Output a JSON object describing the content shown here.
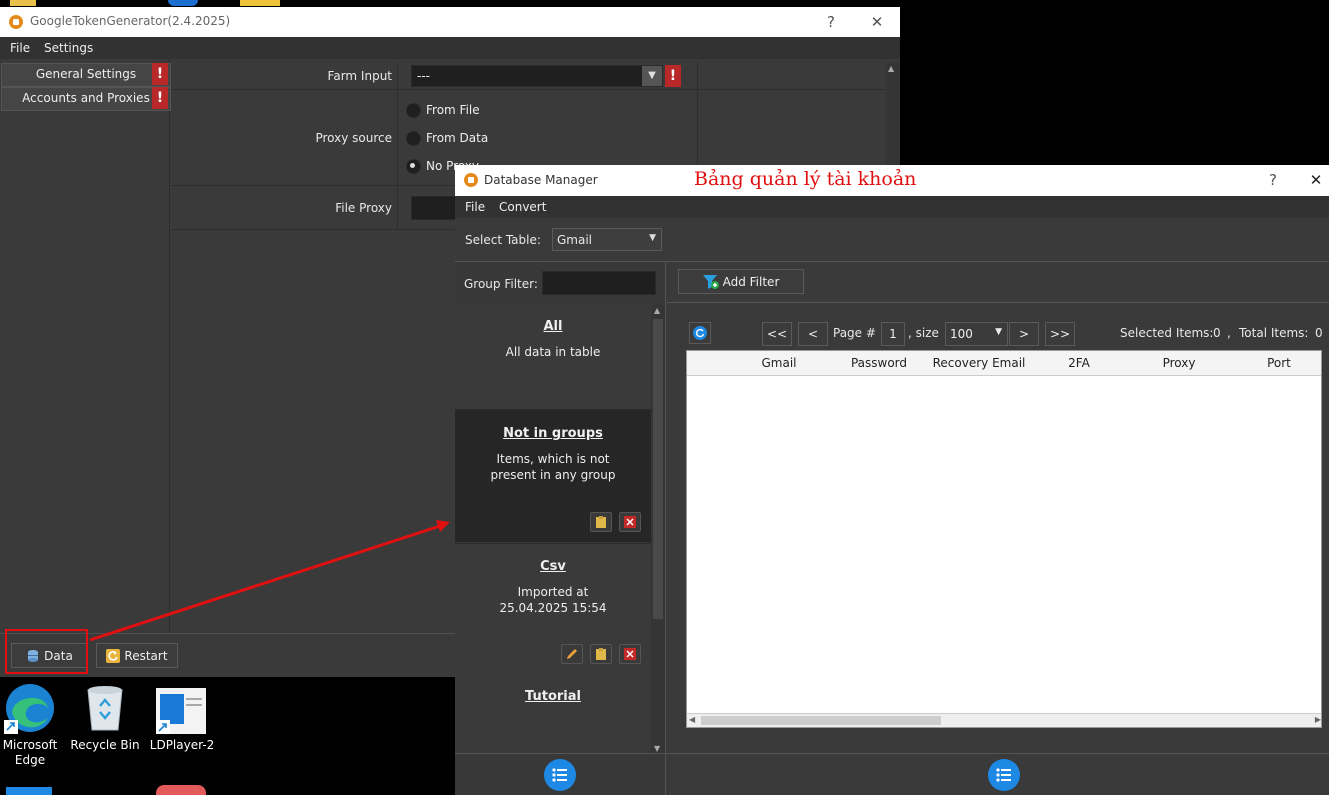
{
  "main_window": {
    "title": "GoogleTokenGenerator(2.4.2025)",
    "help": "?",
    "close": "✕",
    "menu": [
      "File",
      "Settings"
    ],
    "nav": [
      {
        "label": "General Settings",
        "warn": "!"
      },
      {
        "label": "Accounts and Proxies",
        "warn": "!"
      }
    ],
    "farm_input": {
      "label": "Farm Input",
      "value": "---",
      "warn": "!"
    },
    "proxy_source": {
      "label": "Proxy source",
      "options": [
        "From File",
        "From Data",
        "No Proxy"
      ],
      "selected": "No Proxy"
    },
    "file_proxy": {
      "label": "File Proxy"
    },
    "data_button": "Data",
    "restart_button": "Restart"
  },
  "annotation": {
    "text": "Bảng quản lý tài khoản",
    "color": "#e01010"
  },
  "desktop_icons": [
    {
      "label": "Microsoft Edge",
      "icon": "edge-icon"
    },
    {
      "label": "Recycle Bin",
      "icon": "recycle-bin-icon"
    },
    {
      "label": "LDPlayer-2",
      "icon": "ldplayer-icon"
    }
  ],
  "db_window": {
    "title": "Database Manager",
    "help": "?",
    "close": "✕",
    "menu": [
      "File",
      "Convert"
    ],
    "select_table": {
      "label": "Select Table:",
      "value": "Gmail"
    },
    "group_filter": {
      "label": "Group Filter:",
      "value": ""
    },
    "add_filter": "Add Filter",
    "groups": [
      {
        "title": "All",
        "desc": "All data in table"
      },
      {
        "title": "Not in groups",
        "desc": "Items, which is not present in any group"
      },
      {
        "title": "Csv",
        "desc": "Imported at 25.04.2025 15:54"
      },
      {
        "title": "Tutorial",
        "desc": ""
      }
    ],
    "pagination": {
      "first": "<<",
      "prev": "<",
      "page_label": "Page #",
      "page": "1",
      "size_label": ", size",
      "size": "100",
      "next": ">",
      "last": ">>",
      "selected_label": "Selected Items:",
      "selected": "0",
      "sep": ",",
      "total_label": "Total Items:",
      "total": "0"
    },
    "columns": [
      "Gmail",
      "Password",
      "Recovery Email",
      "2FA",
      "Proxy",
      "Port"
    ]
  },
  "colors": {
    "accent_blue": "#1e88e5",
    "warn_red": "#b92828",
    "arrow_red": "#e01010"
  }
}
